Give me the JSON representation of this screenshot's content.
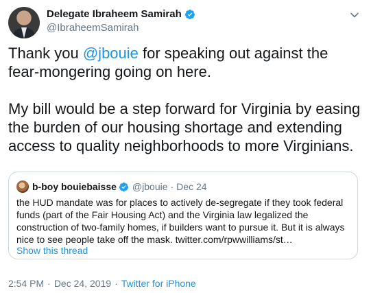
{
  "author": {
    "display_name": "Delegate Ibraheem Samirah",
    "handle": "@IbraheemSamirah"
  },
  "tweet": {
    "para1": {
      "before": "Thank you ",
      "mention": "@jbouie",
      "after": " for speaking out against the fear-mongering going on here."
    },
    "para2": "My bill would be a step forward for Virginia by easing the burden of our housing shortage and extending access to quality neighborhoods to more Virginians."
  },
  "quoted": {
    "display_name": "b-boy bouiebaisse",
    "handle": "@jbouie",
    "separator": "·",
    "date": "Dec 24",
    "text": "the HUD mandate was for places to actively de-segregate if they took federal funds (part of the Fair Housing Act) and the Virginia law legalized the construction of two-family homes, if builders want to pursue it. But it is always nice to see people take off the mask. twitter.com/rpwwilliams/st…",
    "show_thread": "Show this thread"
  },
  "meta": {
    "time": "2:54 PM",
    "separator": "·",
    "date": "Dec 24, 2019",
    "source": "Twitter for iPhone"
  },
  "colors": {
    "link": "#1b95e0",
    "secondary": "#657786",
    "border": "#ccd6dd"
  },
  "icons": {
    "verified": "verified-badge-icon",
    "chevron": "chevron-down-icon"
  }
}
